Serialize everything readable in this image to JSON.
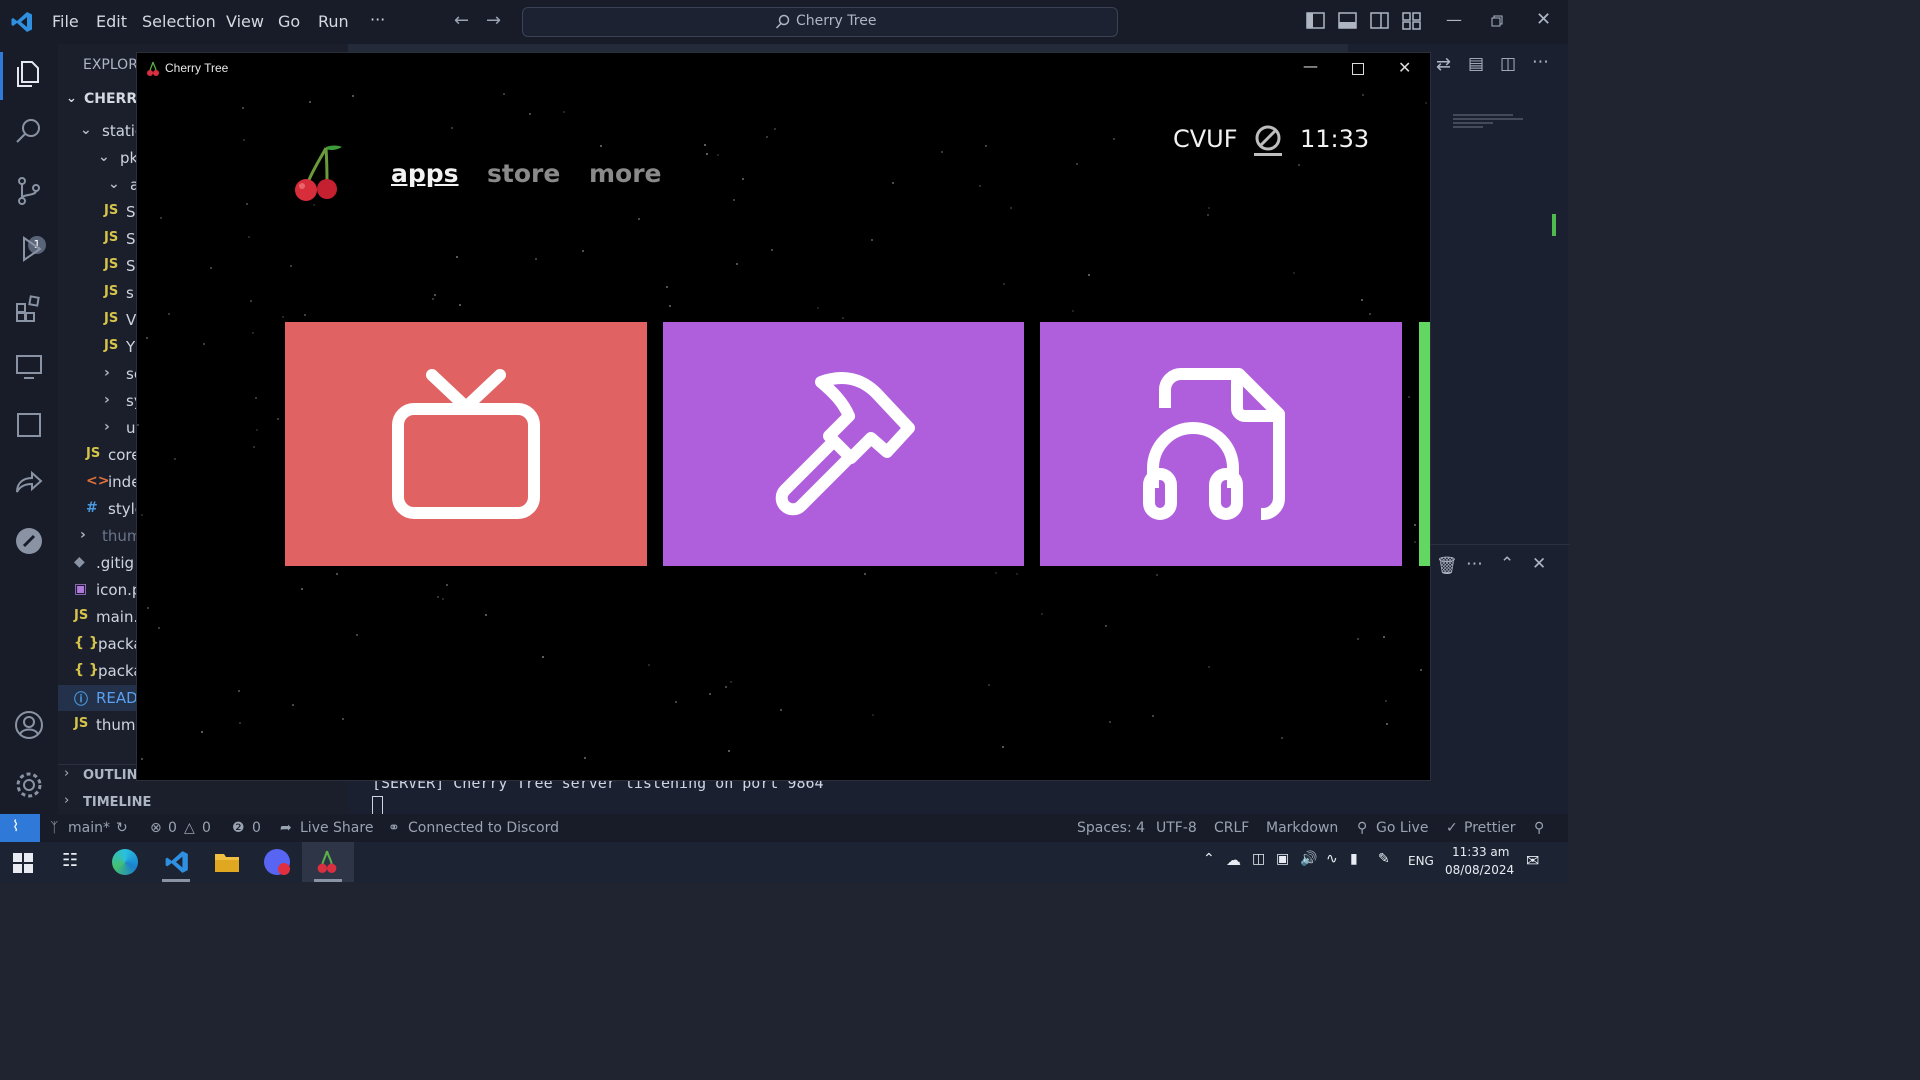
{
  "vscode": {
    "menu": [
      "File",
      "Edit",
      "Selection",
      "View",
      "Go",
      "Run",
      "···"
    ],
    "command_center": "Cherry Tree",
    "activity_badge": "1",
    "sidebar": {
      "header": "EXPLORE",
      "root": "CHERRY",
      "items": [
        {
          "label": "static",
          "kind": "folder-open"
        },
        {
          "label": "pkg",
          "kind": "folder-open"
        },
        {
          "label": "ap",
          "kind": "folder-open"
        },
        {
          "label": "S",
          "kind": "js"
        },
        {
          "label": "S",
          "kind": "js"
        },
        {
          "label": "S",
          "kind": "js"
        },
        {
          "label": "s",
          "kind": "js"
        },
        {
          "label": "V",
          "kind": "js"
        },
        {
          "label": "Y",
          "kind": "js"
        },
        {
          "label": "se",
          "kind": "folder"
        },
        {
          "label": "sys",
          "kind": "folder"
        },
        {
          "label": "ui",
          "kind": "folder"
        },
        {
          "label": "core",
          "kind": "js"
        },
        {
          "label": "inde",
          "kind": "html"
        },
        {
          "label": "style",
          "kind": "css"
        },
        {
          "label": "thum",
          "kind": "folder"
        },
        {
          "label": ".gitig",
          "kind": "git"
        },
        {
          "label": "icon.p",
          "kind": "image"
        },
        {
          "label": "main.",
          "kind": "js"
        },
        {
          "label": "packa",
          "kind": "json"
        },
        {
          "label": "packa",
          "kind": "json"
        },
        {
          "label": "READ",
          "kind": "info"
        },
        {
          "label": "thum",
          "kind": "js"
        }
      ],
      "outline": "OUTLINE",
      "timeline": "TIMELINE"
    },
    "terminal": {
      "line": "[SERVER] Cherry Tree server listening on port 9864"
    },
    "statusbar": {
      "branch": "main*",
      "errors": "0",
      "warnings": "0",
      "ports": "0",
      "live_share": "Live Share",
      "discord": "Connected to Discord",
      "spaces": "Spaces: 4",
      "encoding": "UTF-8",
      "eol": "CRLF",
      "language": "Markdown",
      "go_live": "Go Live",
      "prettier": "Prettier"
    }
  },
  "app": {
    "window_title": "Cherry Tree",
    "nav": [
      "apps",
      "store",
      "more"
    ],
    "active_nav": "apps",
    "user_code": "CVUF",
    "time": "11:33",
    "tiles": [
      {
        "icon": "tv-icon",
        "color": "#e06262"
      },
      {
        "icon": "hammer-icon",
        "color": "#b05fdc"
      },
      {
        "icon": "music-file-icon",
        "color": "#b05fdc"
      }
    ],
    "next_tile_color": "#62d862"
  },
  "taskbar": {
    "lang": "ENG",
    "time": "11:33 am",
    "date": "08/08/2024"
  },
  "colors": {
    "accent": "#2f7ad8",
    "tile_red": "#e06262",
    "tile_purple": "#b05fdc",
    "tile_green": "#62d862"
  }
}
